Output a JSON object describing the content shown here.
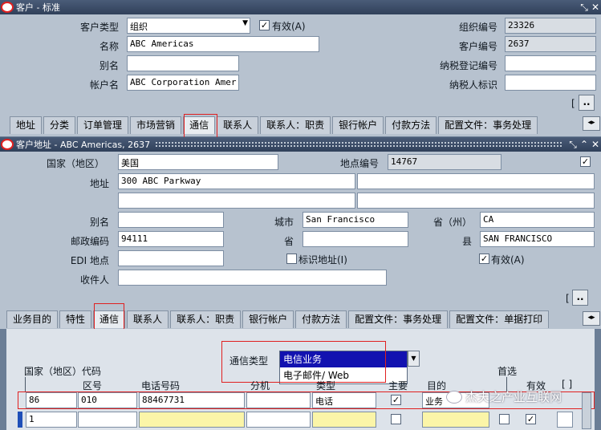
{
  "window1": {
    "title": "客户 - 标准",
    "fields": {
      "customer_type_label": "客户类型",
      "customer_type_value": "组织",
      "active_label": "有效(A)",
      "org_number_label": "组织编号",
      "org_number_value": "23326",
      "name_label": "名称",
      "name_value": "ABC Americas",
      "customer_number_label": "客户编号",
      "customer_number_value": "2637",
      "alias_label": "别名",
      "alias_value": "",
      "tax_reg_label": "纳税登记编号",
      "tax_reg_value": "",
      "account_name_label": "帐户名",
      "account_name_value": "ABC Corporation Amer",
      "taxpayer_id_label": "纳税人标识",
      "taxpayer_id_value": ""
    },
    "more_button": "..",
    "tabs": [
      "地址",
      "分类",
      "订单管理",
      "市场营销",
      "通信",
      "联系人",
      "联系人：职责",
      "银行帐户",
      "付款方法",
      "配置文件：事务处理"
    ]
  },
  "window2": {
    "title": "客户地址 - ABC Americas, 2637",
    "fields": {
      "country_label": "国家（地区）",
      "country_value": "美国",
      "site_number_label": "地点编号",
      "site_number_value": "14767",
      "address_label": "地址",
      "address_line1": "300 ABC Parkway",
      "alias_label": "别名",
      "city_label": "城市",
      "city_value": "San Francisco",
      "province_label": "省（州）",
      "province_value": "CA",
      "postal_label": "邮政编码",
      "postal_value": "94111",
      "state_label": "省",
      "county_label": "县",
      "county_value": "SAN FRANCISCO",
      "edi_label": "EDI 地点",
      "identify_label": "标识地址(I)",
      "active_label": "有效(A)",
      "recipient_label": "收件人"
    },
    "more_button": "..",
    "tabs": [
      "业务目的",
      "特性",
      "通信",
      "联系人",
      "联系人：职责",
      "银行帐户",
      "付款方法",
      "配置文件：事务处理",
      "配置文件：单据打印"
    ]
  },
  "comm": {
    "comm_type_label": "通信类型",
    "comm_type_options": [
      "电信业务",
      "电子邮件/ Web"
    ],
    "col_country_code": "国家（地区）代码",
    "col_area_code": "区号",
    "col_phone": "电话号码",
    "col_ext": "分机",
    "col_type": "类型",
    "col_primary": "主要",
    "col_purpose": "目的",
    "col_preferred": "首选",
    "col_active": "有效",
    "col_bracket": "[ ]",
    "row1": {
      "country_code": "86",
      "area_code": "010",
      "phone": "88467731",
      "ext": "",
      "type": "电话",
      "purpose": "业务"
    },
    "row2": {
      "country_code": "1"
    }
  },
  "watermark": "杰夫之产业互联网"
}
